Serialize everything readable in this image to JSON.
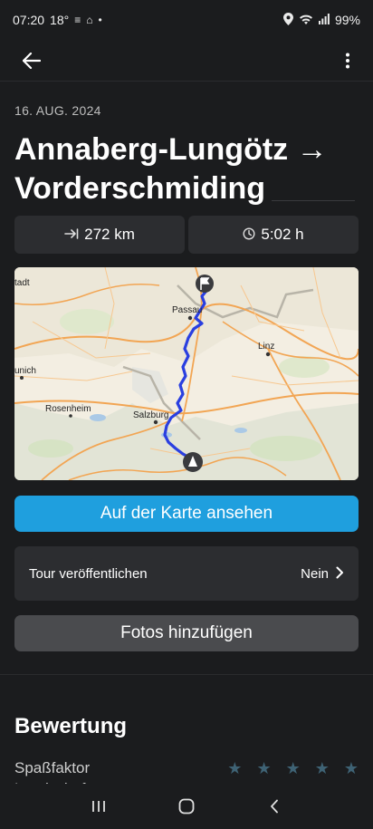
{
  "status_bar": {
    "time": "07:20",
    "temperature": "18°",
    "battery": "99%",
    "icons": [
      "notification-icon",
      "home-icon",
      "dot-icon",
      "location-icon",
      "wifi-icon",
      "signal-icon"
    ]
  },
  "app_bar": {
    "back_icon": "arrow-left-icon",
    "menu_icon": "more-vertical-icon"
  },
  "tour": {
    "date": "16. AUG. 2024",
    "title": "Annaberg-Lungötz → Vorderschmiding",
    "distance": "272 km",
    "duration": "5:02 h",
    "distance_icon": "distance-icon",
    "duration_icon": "clock-icon"
  },
  "map": {
    "labels": [
      "Passau",
      "Linz",
      "Salzburg",
      "Rosenheim",
      "unich",
      "tadt"
    ]
  },
  "actions": {
    "view_on_map": "Auf der Karte ansehen",
    "publish_label": "Tour veröffentlichen",
    "publish_value": "Nein",
    "add_photos": "Fotos hinzufügen"
  },
  "rating": {
    "title": "Bewertung",
    "item_1": "Spaßfaktor",
    "item_2": "Landschaft"
  },
  "colors": {
    "background": "#1b1c1e",
    "card": "#2c2d30",
    "accent": "#1f9fde",
    "route": "#2a3fe0"
  }
}
